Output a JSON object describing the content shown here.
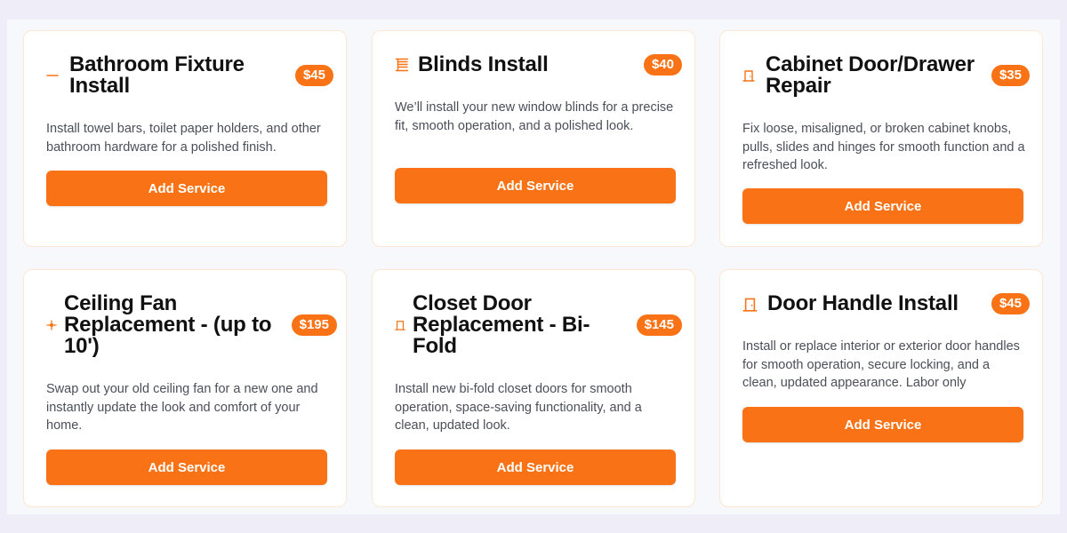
{
  "accent_color": "#f97316",
  "cards": [
    {
      "title": "Bathroom Fixture Install",
      "price": "$45",
      "icon": "minus-icon",
      "description": "Install towel bars, toilet paper holders, and other bathroom hardware for a polished finish.",
      "button_label": "Add Service"
    },
    {
      "title": "Blinds Install",
      "price": "$40",
      "icon": "blinds-icon",
      "description": "We’ll install your new window blinds for a precise fit, smooth operation, and a polished look.",
      "button_label": "Add Service"
    },
    {
      "title": "Cabinet Door/Drawer Repair",
      "price": "$35",
      "icon": "door-icon",
      "description": "Fix loose, misaligned, or broken cabinet knobs, pulls, slides and hinges for smooth function and a refreshed look.",
      "button_label": "Add Service"
    },
    {
      "title": "Ceiling Fan Replacement - (up to 10')",
      "price": "$195",
      "icon": "fan-icon",
      "description": "Swap out your old ceiling fan for a new one and instantly update the look and comfort of your home.",
      "button_label": "Add Service"
    },
    {
      "title": "Closet Door Replacement - Bi-Fold",
      "price": "$145",
      "icon": "door-icon",
      "description": "Install new bi-fold closet doors for smooth operation, space-saving functionality, and a clean, updated look.",
      "button_label": "Add Service"
    },
    {
      "title": "Door Handle Install",
      "price": "$45",
      "icon": "door-icon",
      "description": "Install or replace interior or exterior door handles for smooth operation, secure locking, and a clean, updated appearance. Labor only",
      "button_label": "Add Service"
    }
  ]
}
